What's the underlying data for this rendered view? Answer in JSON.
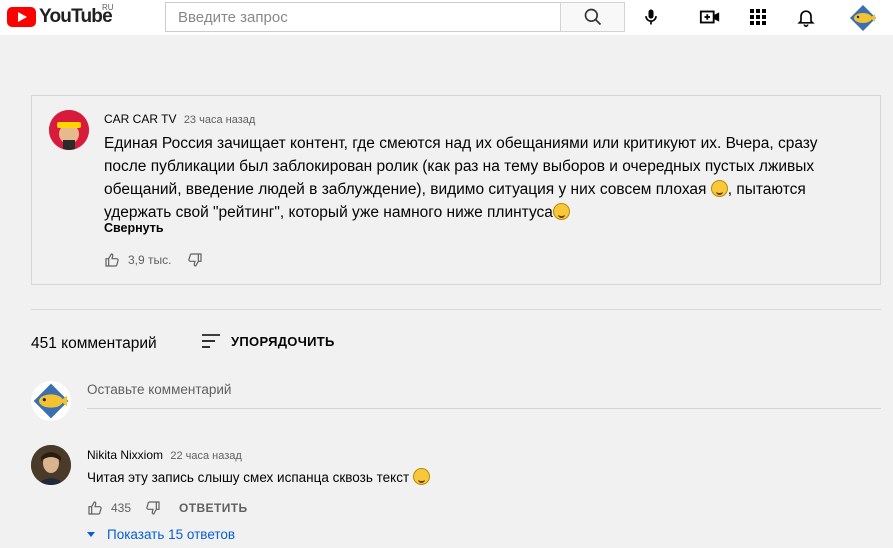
{
  "header": {
    "logo_text": "YouTube",
    "region": "RU",
    "search_placeholder": "Введите запрос",
    "icons": [
      "search-icon",
      "mic-icon",
      "create-video-icon",
      "apps-grid-icon",
      "bell-icon",
      "avatar"
    ],
    "brand_color": "#ff0000"
  },
  "lead_comment": {
    "author": "CAR CAR TV",
    "time": "23 часа назад",
    "text_part1": "Единая Россия зачищает контент, где смеются над их обещаниями или критикуют их. Вчера, сразу после публикации был заблокирован ролик (как раз на тему выборов и очередных пустых лживых обещаний, введение людей в заблуждение), видимо ситуация у них совсем плохая ",
    "text_part2": ", пытаются удержать свой \"рейтинг\", который уже намного ниже плинтуса",
    "collapse_label": "Свернуть",
    "likes": "3,9 тыс.",
    "avatar_label": "CAR CAR TV"
  },
  "comments_section": {
    "count_label": "451 комментарий",
    "sort_label": "УПОРЯДОЧИТЬ",
    "add_comment_placeholder": "Оставьте комментарий"
  },
  "comments": [
    {
      "author": "Nikita Nixxiom",
      "time": "22 часа назад",
      "text": "Читая эту запись слышу смех испанца сквозь текст",
      "likes": "435",
      "reply_label": "ОТВЕТИТЬ",
      "show_replies_label": "Показать 15 ответов"
    }
  ],
  "colors": {
    "link": "#065fd4",
    "secondary_text": "#606060",
    "background": "#f1f1f1"
  }
}
